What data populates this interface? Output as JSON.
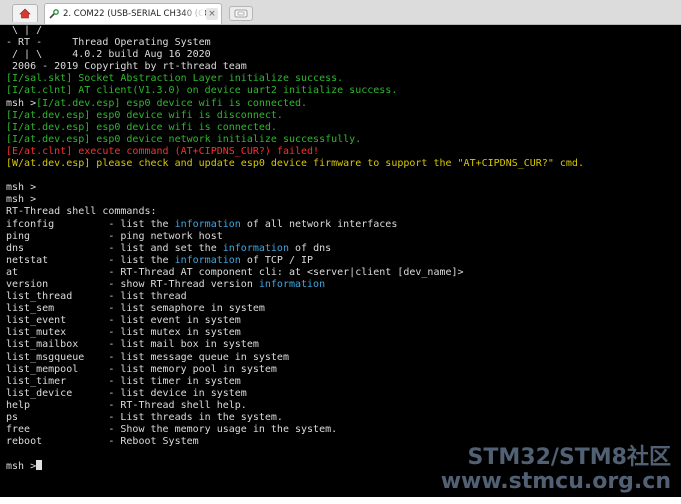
{
  "tabbar": {
    "tab_label": "2. COM22  (USB-SERIAL CH340 (CO",
    "icons": [
      "home-icon",
      "wrench-icon",
      "close-icon",
      "new-tab-icon"
    ]
  },
  "colors": {
    "background": "#000000",
    "text": "#dcdcdc",
    "success": "#2db82d",
    "error": "#ff2f2f",
    "warning": "#d8c800",
    "highlight": "#3fa7de"
  },
  "terminal": {
    "lines": [
      [
        {
          "t": " \\ | /",
          "c": "w"
        }
      ],
      [
        {
          "t": "- RT -     Thread Operating System",
          "c": "w"
        }
      ],
      [
        {
          "t": " / | \\     4.0.2 build Aug 16 2020",
          "c": "w"
        }
      ],
      [
        {
          "t": " 2006 - 2019 Copyright by rt-thread team",
          "c": "w"
        }
      ],
      [
        {
          "t": "[I/sal.skt] Socket Abstraction Layer initialize success.",
          "c": "g"
        }
      ],
      [
        {
          "t": "[I/at.clnt] AT client(V1.3.0) on device uart2 initialize success.",
          "c": "g"
        }
      ],
      [
        {
          "t": "msh >",
          "c": "w"
        },
        {
          "t": "[I/at.dev.esp] esp0 device wifi is connected.",
          "c": "g"
        }
      ],
      [
        {
          "t": "[I/at.dev.esp] esp0 device wifi is disconnect.",
          "c": "g"
        }
      ],
      [
        {
          "t": "[I/at.dev.esp] esp0 device wifi is connected.",
          "c": "g"
        }
      ],
      [
        {
          "t": "[I/at.dev.esp] esp0 device network initialize successfully.",
          "c": "g"
        }
      ],
      [
        {
          "t": "[E/at.clnt] execute command (AT+CIPDNS_CUR?) failed!",
          "c": "r"
        }
      ],
      [
        {
          "t": "[W/at.dev.esp] please check and update esp0 device firmware to support the \"AT+CIPDNS_CUR?\" cmd.",
          "c": "y"
        }
      ],
      [
        {
          "t": "",
          "c": "w"
        }
      ],
      [
        {
          "t": "msh >",
          "c": "w"
        }
      ],
      [
        {
          "t": "msh >",
          "c": "w"
        }
      ],
      [
        {
          "t": "RT-Thread shell commands:",
          "c": "w"
        }
      ],
      [
        {
          "t": "ifconfig         - list the ",
          "c": "w"
        },
        {
          "t": "information",
          "c": "c"
        },
        {
          "t": " of all network interfaces",
          "c": "w"
        }
      ],
      [
        {
          "t": "ping             - ping network host",
          "c": "w"
        }
      ],
      [
        {
          "t": "dns              - list and set the ",
          "c": "w"
        },
        {
          "t": "information",
          "c": "c"
        },
        {
          "t": " of dns",
          "c": "w"
        }
      ],
      [
        {
          "t": "netstat          - list the ",
          "c": "w"
        },
        {
          "t": "information",
          "c": "c"
        },
        {
          "t": " of TCP / IP",
          "c": "w"
        }
      ],
      [
        {
          "t": "at               - RT-Thread AT component cli: at <server|client [dev_name]>",
          "c": "w"
        }
      ],
      [
        {
          "t": "version          - show RT-Thread version ",
          "c": "w"
        },
        {
          "t": "information",
          "c": "c"
        }
      ],
      [
        {
          "t": "list_thread      - list thread",
          "c": "w"
        }
      ],
      [
        {
          "t": "list_sem         - list semaphore in system",
          "c": "w"
        }
      ],
      [
        {
          "t": "list_event       - list event in system",
          "c": "w"
        }
      ],
      [
        {
          "t": "list_mutex       - list mutex in system",
          "c": "w"
        }
      ],
      [
        {
          "t": "list_mailbox     - list mail box in system",
          "c": "w"
        }
      ],
      [
        {
          "t": "list_msgqueue    - list message queue in system",
          "c": "w"
        }
      ],
      [
        {
          "t": "list_mempool     - list memory pool in system",
          "c": "w"
        }
      ],
      [
        {
          "t": "list_timer       - list timer in system",
          "c": "w"
        }
      ],
      [
        {
          "t": "list_device      - list device in system",
          "c": "w"
        }
      ],
      [
        {
          "t": "help             - RT-Thread shell help.",
          "c": "w"
        }
      ],
      [
        {
          "t": "ps               - List threads in the system.",
          "c": "w"
        }
      ],
      [
        {
          "t": "free             - Show the memory usage in the system.",
          "c": "w"
        }
      ],
      [
        {
          "t": "reboot           - Reboot System",
          "c": "w"
        }
      ],
      [
        {
          "t": "",
          "c": "w"
        }
      ],
      [
        {
          "t": "msh >",
          "c": "w"
        }
      ]
    ],
    "prompt_line_index": 36
  },
  "watermark": {
    "line1": "STM32/STM8社区",
    "line2": "www.stmcu.org.cn"
  }
}
